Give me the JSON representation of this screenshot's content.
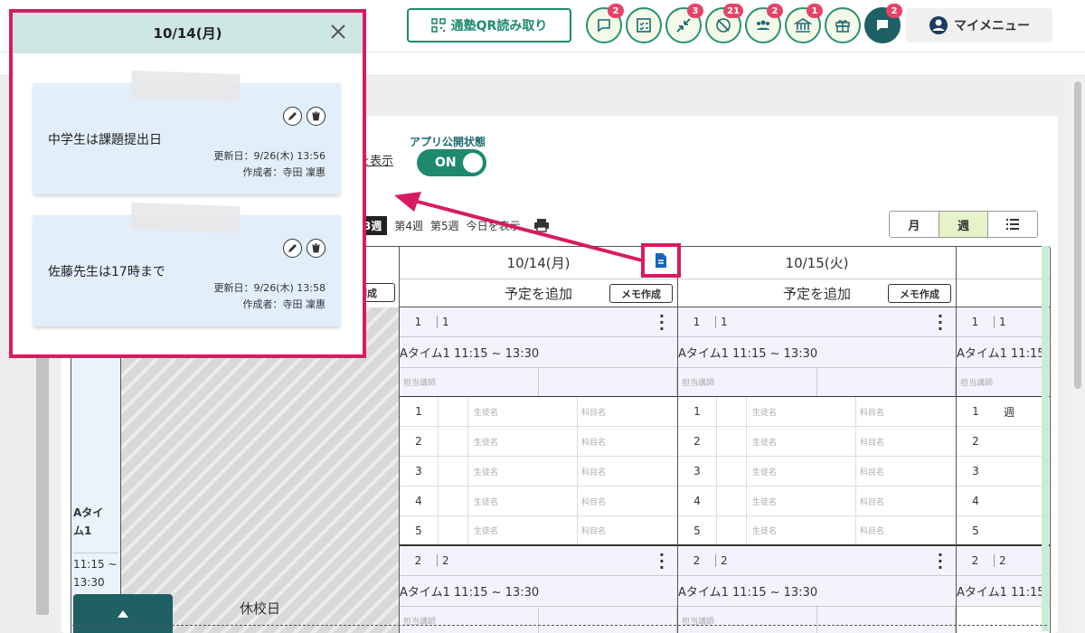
{
  "header": {
    "qr_button": "通塾QR読み取り",
    "icons": [
      {
        "name": "chat-icon",
        "badge": "2"
      },
      {
        "name": "checklist-icon",
        "badge": ""
      },
      {
        "name": "compress-arrows-icon",
        "badge": "3"
      },
      {
        "name": "no-location-icon",
        "badge": "21"
      },
      {
        "name": "group-icon",
        "badge": "2"
      },
      {
        "name": "bank-icon",
        "badge": "1"
      },
      {
        "name": "gift-icon",
        "badge": ""
      },
      {
        "name": "message-icon",
        "badge": "2"
      }
    ],
    "my_menu": "マイメニュー"
  },
  "toolbar": {
    "show_link": "を表示",
    "app_status_label": "アプリ公開状態",
    "toggle_label": "ON",
    "week_current": "3週",
    "week_4": "第4週",
    "week_5": "第5週",
    "today": "今日を表示",
    "views": [
      "月",
      "週",
      "list-icon"
    ]
  },
  "calendar": {
    "left_memo_btn": "作成",
    "holiday_label": "休校日",
    "time_slot_name": "Aタイ\nム1",
    "time_slot_time": "11:15 ~\n13:30",
    "days": [
      {
        "date": "10/14(月)",
        "add": "予定を追加",
        "memo": "メモ作成"
      },
      {
        "date": "10/15(火)",
        "add": "予定を追加",
        "memo": "メモ作成"
      }
    ],
    "slot1": {
      "num": "1",
      "label": "1",
      "time": "Aタイム1 11:15 ~ 13:30",
      "teacher": "担当講師"
    },
    "slot2": {
      "num": "2",
      "label": "2",
      "time": "Aタイム1 11:15 ~ 13:30",
      "teacher": "担当講師"
    },
    "rows": [
      "1",
      "2",
      "3",
      "4",
      "5"
    ],
    "student_placeholder": "生徒名",
    "subject_placeholder": "科目名",
    "partial_col_text": "週"
  },
  "popup": {
    "title": "10/14(月)",
    "memos": [
      {
        "title": "中学生は課題提出日",
        "updated": "更新日：9/26(木) 13:56",
        "author": "作成者：寺田 凜惠"
      },
      {
        "title": "佐藤先生は17時まで",
        "updated": "更新日：9/26(木) 13:58",
        "author": "作成者：寺田 凜惠"
      }
    ]
  },
  "colors": {
    "accent": "#1d8a6e",
    "highlight": "#d81b60",
    "badge": "#e54468",
    "dark_teal": "#1e6064"
  }
}
